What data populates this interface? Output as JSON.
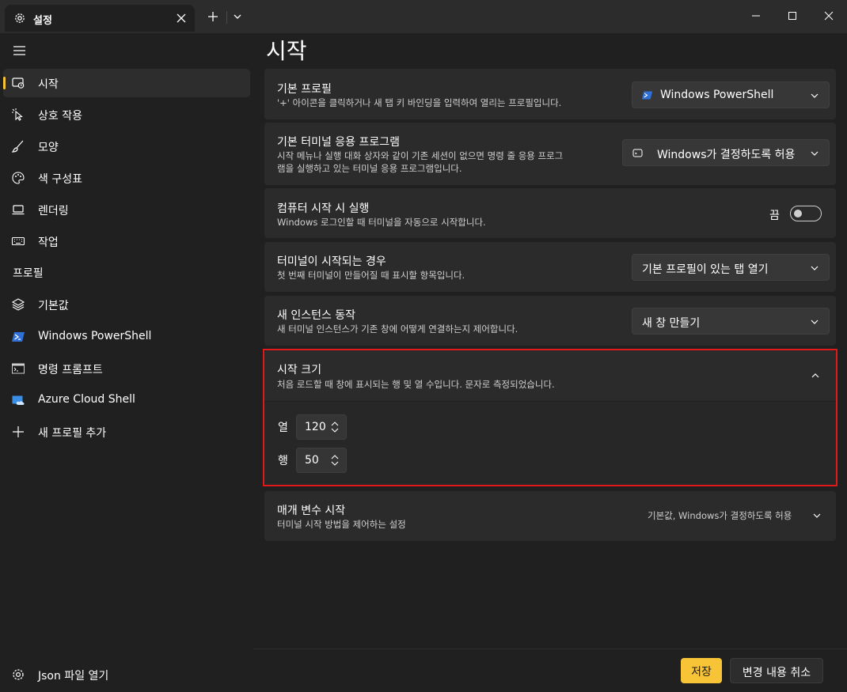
{
  "tab": {
    "title": "설정"
  },
  "sidebar": {
    "items": [
      {
        "label": "시작"
      },
      {
        "label": "상호 작용"
      },
      {
        "label": "모양"
      },
      {
        "label": "색 구성표"
      },
      {
        "label": "렌더링"
      },
      {
        "label": "작업"
      }
    ],
    "profiles_header": "프로필",
    "profiles": [
      {
        "label": "기본값"
      },
      {
        "label": "Windows PowerShell"
      },
      {
        "label": "명령 프롬프트"
      },
      {
        "label": "Azure Cloud Shell"
      },
      {
        "label": "새 프로필 추가"
      }
    ],
    "json_label": "Json 파일 열기"
  },
  "main": {
    "title": "시작",
    "default_profile": {
      "title": "기본 프로필",
      "desc": "'+' 아이콘을 클릭하거나 새 탭 키 바인딩을 입력하여 열리는 프로필입니다.",
      "value": "Windows PowerShell"
    },
    "default_terminal": {
      "title": "기본 터미널 응용 프로그램",
      "desc_line1": "시작 메뉴나 실행 대화 상자와 같이 기존 세션이 없으면 명령 줄 응용 프로그",
      "desc_line2": "램을 실행하고 있는 터미널 응용 프로그램입니다.",
      "value": "Windows가 결정하도록 허용"
    },
    "launch_on_startup": {
      "title": "컴퓨터 시작 시 실행",
      "desc": "Windows 로그인할 때 터미널을 자동으로 시작합니다.",
      "toggle_label": "끔",
      "toggle_on": false
    },
    "when_terminal_starts": {
      "title": "터미널이 시작되는 경우",
      "desc": "첫 번째 터미널이 만들어질 때 표시할 항목입니다.",
      "value": "기본 프로필이 있는 탭 열기"
    },
    "new_instance": {
      "title": "새 인스턴스 동작",
      "desc": "새 터미널 인스턴스가 기존 창에 어떻게 연결하는지 제어합니다.",
      "value": "새 창 만들기"
    },
    "launch_size": {
      "title": "시작 크기",
      "desc": "처음 로드할 때 창에 표시되는 행 및 열 수입니다. 문자로 측정되었습니다.",
      "columns_label": "열",
      "columns_value": "120",
      "rows_label": "행",
      "rows_value": "50"
    },
    "launch_parameters": {
      "title": "매개 변수 시작",
      "desc": "터미널 시작 방법을 제어하는 설정",
      "summary": "기본값, Windows가 결정하도록 허용"
    }
  },
  "footer": {
    "save_label": "저장",
    "discard_label": "변경 내용 취소"
  },
  "colors": {
    "accent": "#f7c437",
    "highlight_border": "#e01a1a",
    "background": "#202020",
    "card": "#2b2b2b"
  }
}
